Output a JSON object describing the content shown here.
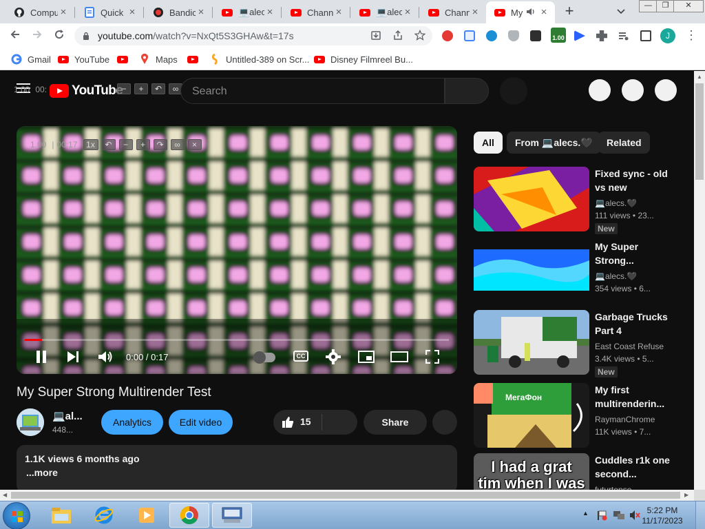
{
  "browser": {
    "tabs": [
      {
        "title": "Compu",
        "favicon": "github-icon"
      },
      {
        "title": "Quick",
        "favicon": "docs-icon"
      },
      {
        "title": "Bandic",
        "favicon": "record-icon"
      },
      {
        "title": "💻alecs",
        "favicon": "youtube-icon"
      },
      {
        "title": "Chann",
        "favicon": "youtube-icon"
      },
      {
        "title": "💻alecs",
        "favicon": "youtube-icon"
      },
      {
        "title": "Chann",
        "favicon": "youtube-icon"
      },
      {
        "title": "My",
        "favicon": "youtube-icon",
        "active": true,
        "audio": "speaker-icon"
      }
    ],
    "url_host": "youtube.com",
    "url_rest": "/watch?v=NxQt5S3GHAw&t=17s",
    "profile_initial": "J",
    "extension_badge": "1.00",
    "bookmarks": [
      {
        "label": "Gmail",
        "icon": "gmail-icon"
      },
      {
        "label": "YouTube",
        "icon": "youtube-icon"
      },
      {
        "label": "",
        "icon": "youtube-icon"
      },
      {
        "label": "Maps",
        "icon": "maps-icon"
      },
      {
        "label": "",
        "icon": "youtube-icon"
      },
      {
        "label": "Untitled-389 on Scr...",
        "icon": "scratch-icon"
      },
      {
        "label": "Disney Filmreel Bu...",
        "icon": "youtube-icon"
      }
    ]
  },
  "youtube": {
    "logo_text": "YouTube",
    "search_placeholder": "Search",
    "overlay_header": {
      "speed": "1.00",
      "time": "00:"
    },
    "overlay_player": {
      "speed": "1.00",
      "time": "00:17",
      "rate": "1x"
    },
    "player": {
      "current_time": "0:00",
      "duration": "0:17",
      "time_display": "0:00 / 0:17",
      "progress_fraction": 0.04,
      "cc_label": "CC"
    },
    "video": {
      "title": "My Super Strong Multirender Test",
      "channel_name": "💻al...",
      "subscribers": "448...",
      "analytics_label": "Analytics",
      "edit_label": "Edit video",
      "likes": "15",
      "share_label": "Share",
      "views_and_date": "1.1K views  6 months ago",
      "more_label": "...more"
    },
    "chips": [
      "All",
      "From 💻alecs.🖤",
      "Related"
    ],
    "recommendations": [
      {
        "title": "Fixed sync - old vs new",
        "channel": "💻alecs.🖤",
        "views": "111 views • 23...",
        "badge": "New"
      },
      {
        "title": "My Super Strong...",
        "channel": "💻alecs.🖤",
        "views": "354 views • 6...",
        "badge": ""
      },
      {
        "title": "Garbage Trucks Part 4",
        "channel": "East Coast Refuse",
        "views": "3.4K views • 5...",
        "badge": "New"
      },
      {
        "title": "My first multirenderin...",
        "channel": "RaymanChrome",
        "views": "11K views • 7...",
        "badge": ""
      },
      {
        "title": "Cuddles r1k one second...",
        "channel": "futurtense",
        "views": "",
        "badge": "",
        "thumb_text": "I had a grat tim when I was"
      }
    ],
    "thumb_texts": {
      "megafon": "МегаФон"
    }
  },
  "taskbar": {
    "time": "5:22 PM",
    "date": "11/17/2023"
  },
  "colors": {
    "accent_red": "#ff0000",
    "blue_button": "#3ea6ff",
    "dark_bg": "#0f0f0f"
  }
}
